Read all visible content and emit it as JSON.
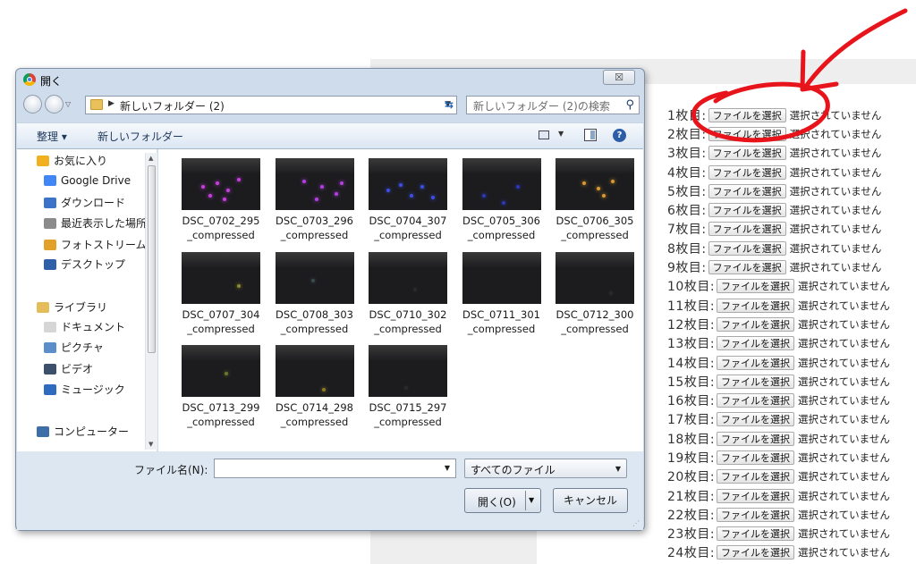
{
  "dialog": {
    "title": "開く",
    "close_label": "☒",
    "address_path": "新しいフォルダー (2)",
    "search_placeholder": "新しいフォルダー (2)の検索",
    "toolbar": {
      "organize": "整理 ▾",
      "new_folder": "新しいフォルダー"
    },
    "sidebar": [
      {
        "label": "お気に入り",
        "icon": "star-icon",
        "color": "#f2b01e"
      },
      {
        "label": "Google Drive",
        "icon": "google-drive-icon",
        "color": "#4285f4"
      },
      {
        "label": "ダウンロード",
        "icon": "download-folder-icon",
        "color": "#3b73c8"
      },
      {
        "label": "最近表示した場所",
        "icon": "recent-places-icon",
        "color": "#8b8b8b"
      },
      {
        "label": "フォトストリーム",
        "icon": "photostream-icon",
        "color": "#e2a12a"
      },
      {
        "label": "デスクトップ",
        "icon": "desktop-icon",
        "color": "#2f5fa8"
      },
      {
        "label": "ライブラリ",
        "icon": "library-icon",
        "color": "#e4bd5a"
      },
      {
        "label": "ドキュメント",
        "icon": "document-icon",
        "color": "#d6d6d6"
      },
      {
        "label": "ピクチャ",
        "icon": "pictures-icon",
        "color": "#5c8fc9"
      },
      {
        "label": "ビデオ",
        "icon": "video-icon",
        "color": "#3c4f6b"
      },
      {
        "label": "ミュージック",
        "icon": "music-icon",
        "color": "#2f6cc0"
      },
      {
        "label": "コンピューター",
        "icon": "computer-icon",
        "color": "#3d6ea8"
      }
    ],
    "files": [
      {
        "name": "DSC_0702_295",
        "suffix": "_compressed",
        "dot": "#c93de0"
      },
      {
        "name": "DSC_0703_296",
        "suffix": "_compressed",
        "dot": "#b23fe0"
      },
      {
        "name": "DSC_0704_307",
        "suffix": "_compressed",
        "dot": "#3d4fe0"
      },
      {
        "name": "DSC_0705_306",
        "suffix": "_compressed",
        "dot": "#2b38b8"
      },
      {
        "name": "DSC_0706_305",
        "suffix": "_compressed",
        "dot": "#d89a2c"
      },
      {
        "name": "DSC_0707_304",
        "suffix": "_compressed",
        "dot": "#8a8a2a"
      },
      {
        "name": "DSC_0708_303",
        "suffix": "_compressed",
        "dot": "#3a4a4a"
      },
      {
        "name": "DSC_0710_302",
        "suffix": "_compressed",
        "dot": "#2a2a2a"
      },
      {
        "name": "DSC_0711_301",
        "suffix": "_compressed",
        "dot": "#1a1a1a"
      },
      {
        "name": "DSC_0712_300",
        "suffix": "_compressed",
        "dot": "#2a2a2a"
      },
      {
        "name": "DSC_0713_299",
        "suffix": "_compressed",
        "dot": "#6a7a2a"
      },
      {
        "name": "DSC_0714_298",
        "suffix": "_compressed",
        "dot": "#8a7a2a"
      },
      {
        "name": "DSC_0715_297",
        "suffix": "_compressed",
        "dot": "#2a2a2a"
      }
    ],
    "filename_label": "ファイル名(N):",
    "filename_value": "",
    "filter_label": "すべてのファイル",
    "open_label": "開く(O)",
    "cancel_label": "キャンセル"
  },
  "slots": {
    "button_label": "ファイルを選択",
    "status_label": "選択されていません",
    "items": [
      "1枚目:",
      "2枚目:",
      "3枚目:",
      "4枚目:",
      "5枚目:",
      "6枚目:",
      "7枚目:",
      "8枚目:",
      "9枚目:",
      "10枚目:",
      "11枚目:",
      "12枚目:",
      "13枚目:",
      "14枚目:",
      "15枚目:",
      "16枚目:",
      "17枚目:",
      "18枚目:",
      "19枚目:",
      "20枚目:",
      "21枚目:",
      "22枚目:",
      "23枚目:",
      "24枚目:"
    ]
  },
  "colors": {
    "annotation_red": "#e8141b",
    "dialog_frame": "#cfdcec"
  }
}
